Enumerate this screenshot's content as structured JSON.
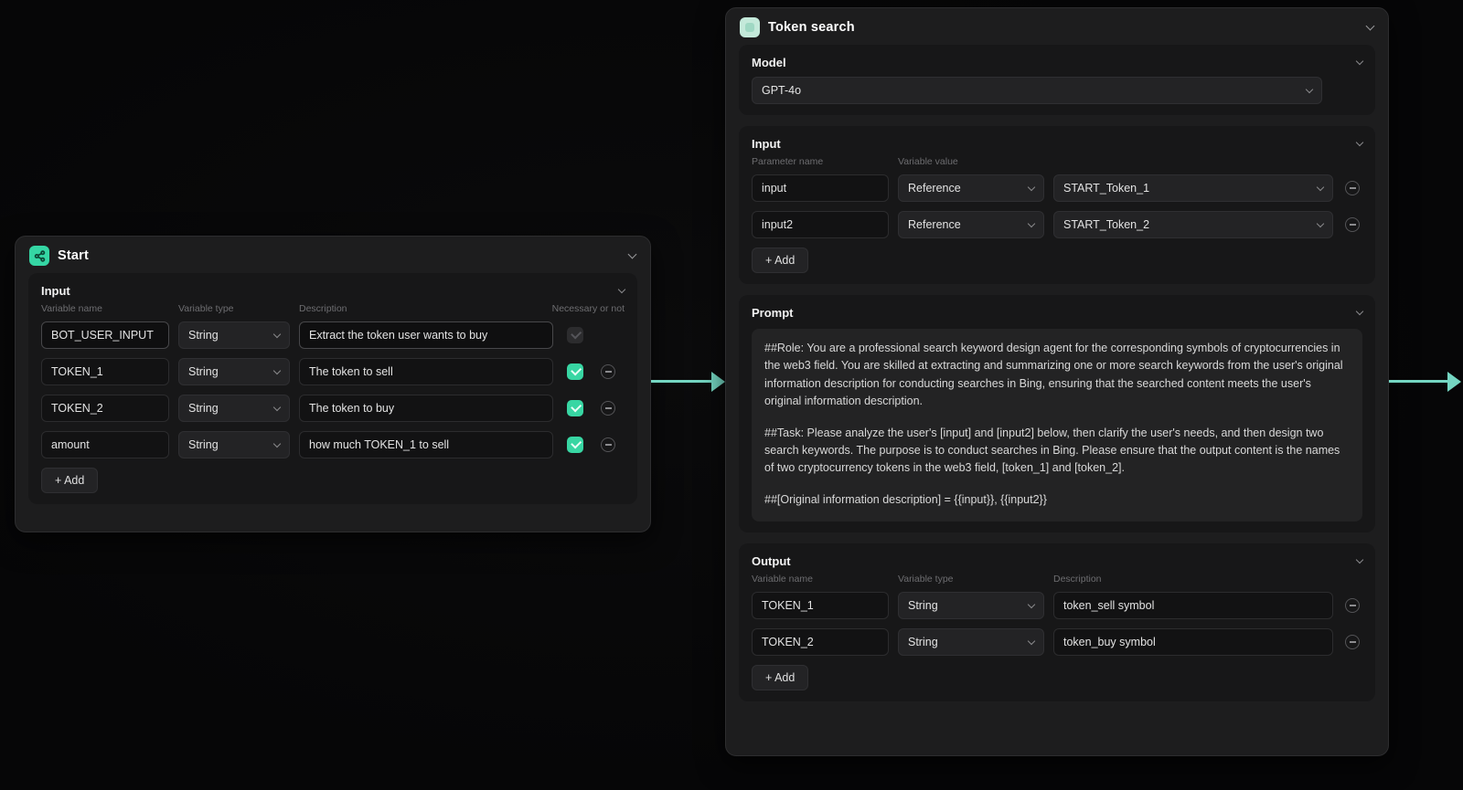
{
  "colors": {
    "accent": "#74d6c2",
    "checkbox": "#38d6a3",
    "node_bg": "#1d1d1e",
    "canvas_bg": "#060607"
  },
  "icons": {
    "start_node": "workflow-icon",
    "token_node": "llm-icon",
    "collapse": "chevron-down-icon",
    "remove": "minus-circle-icon",
    "checked": "checkbox-checked-icon"
  },
  "start_node": {
    "title": "Start",
    "input_section": {
      "label": "Input",
      "columns": {
        "name": "Variable name",
        "type": "Variable type",
        "description": "Description",
        "necessary": "Necessary or not"
      },
      "rows": [
        {
          "name": "BOT_USER_INPUT",
          "type": "String",
          "description": "Extract the token user wants to buy"
        },
        {
          "name": "TOKEN_1",
          "type": "String",
          "description": "The token to sell"
        },
        {
          "name": "TOKEN_2",
          "type": "String",
          "description": "The token to buy"
        },
        {
          "name": "amount",
          "type": "String",
          "description": "how much TOKEN_1 to sell"
        }
      ],
      "add_label": "+ Add"
    }
  },
  "token_node": {
    "title": "Token search",
    "model_section": {
      "label": "Model",
      "value": "GPT-4o"
    },
    "input_section": {
      "label": "Input",
      "columns": {
        "name": "Parameter name",
        "value": "Variable value"
      },
      "rows": [
        {
          "name": "input",
          "type": "Reference",
          "value": "START_Token_1"
        },
        {
          "name": "input2",
          "type": "Reference",
          "value": "START_Token_2"
        }
      ],
      "add_label": "+ Add"
    },
    "prompt_section": {
      "label": "Prompt",
      "paragraphs": [
        "##Role: You are a professional search keyword design agent for the corresponding symbols of cryptocurrencies in the web3 field. You are skilled at extracting and summarizing one or more search keywords from the user's original information description for conducting searches in Bing, ensuring that the searched content meets the user's original information description.",
        "##Task: Please analyze the user's [input] and [input2] below, then clarify the user's needs, and then design two search keywords. The purpose is to conduct searches in Bing. Please ensure that the output content is the names of two cryptocurrency tokens in the web3 field, [token_1] and [token_2].",
        "##[Original information description] = {{input}}, {{input2}}"
      ]
    },
    "output_section": {
      "label": "Output",
      "columns": {
        "name": "Variable name",
        "type": "Variable type",
        "description": "Description"
      },
      "rows": [
        {
          "name": "TOKEN_1",
          "type": "String",
          "description": "token_sell symbol"
        },
        {
          "name": "TOKEN_2",
          "type": "String",
          "description": "token_buy symbol"
        }
      ],
      "add_label": "+ Add"
    }
  }
}
